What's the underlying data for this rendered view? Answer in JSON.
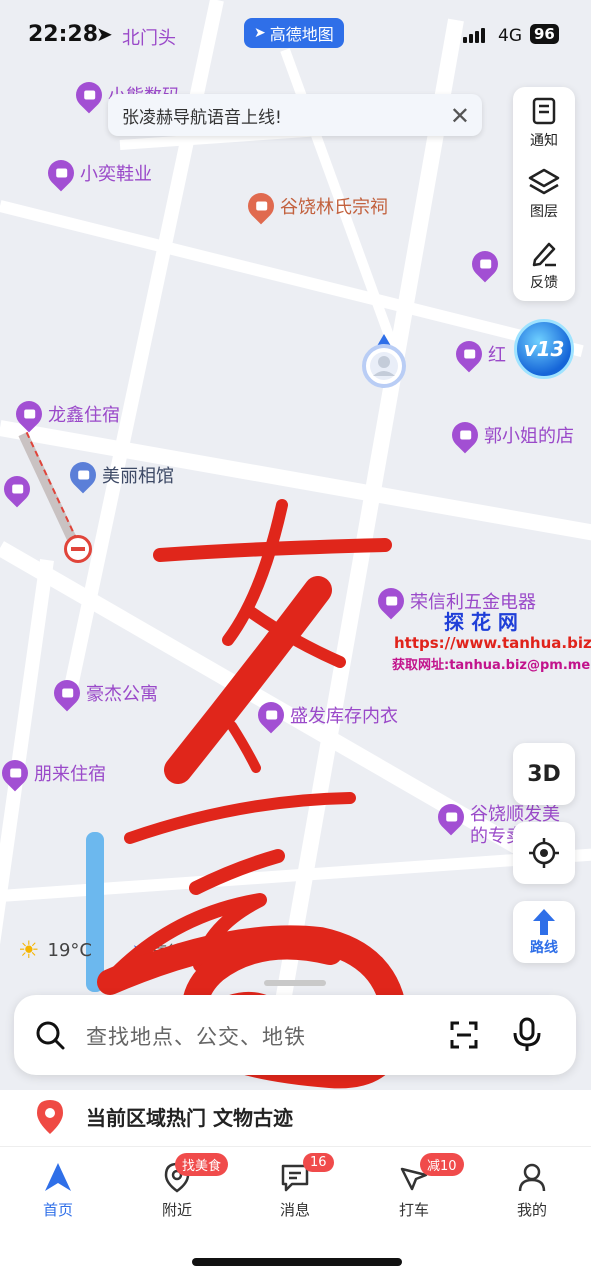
{
  "status": {
    "time": "22:28",
    "network": "4G",
    "battery": "96",
    "app_badge": "高德地图"
  },
  "map": {
    "top_label": "北门头",
    "notice": "张凌赫导航语音上线!",
    "pois": {
      "xiaoneng": "小熊数码",
      "xiaoyi": "小奕鞋业",
      "guraolin": "谷饶林氏宗祠",
      "longxin": "龙鑫住宿",
      "meili": "美丽相馆",
      "guoxiaojie": "郭小姐的店",
      "rongxinli": "荣信利五金电器",
      "haojie": "豪杰公寓",
      "shengfa": "盛发库存内衣",
      "penglai": "朋来住宿",
      "guraoshun": "谷饶顺发美的专卖",
      "hong": "红"
    },
    "weather": "19°C",
    "logo_text": "高德地图",
    "v13_badge": "v13"
  },
  "toolbox": {
    "notify": "通知",
    "layers": "图层",
    "feedback": "反馈"
  },
  "buttons": {
    "threed": "3D",
    "route": "路线"
  },
  "watermark": {
    "title": "探 花 网",
    "url": "https://www.tanhua.biz",
    "contact": "获取网址:tanhua.biz@pm.me"
  },
  "search": {
    "placeholder": "查找地点、公交、地铁"
  },
  "hot_area": "当前区域热门 文物古迹",
  "tabs": {
    "home": "首页",
    "nearby": "附近",
    "nearby_badge": "找美食",
    "messages": "消息",
    "messages_badge": "16",
    "taxi": "打车",
    "taxi_badge": "减10",
    "mine": "我的"
  },
  "colors": {
    "accent": "#2f6fe8",
    "poi": "#a24fd3",
    "badge": "#f04b4b",
    "scribble": "#e0261b"
  }
}
